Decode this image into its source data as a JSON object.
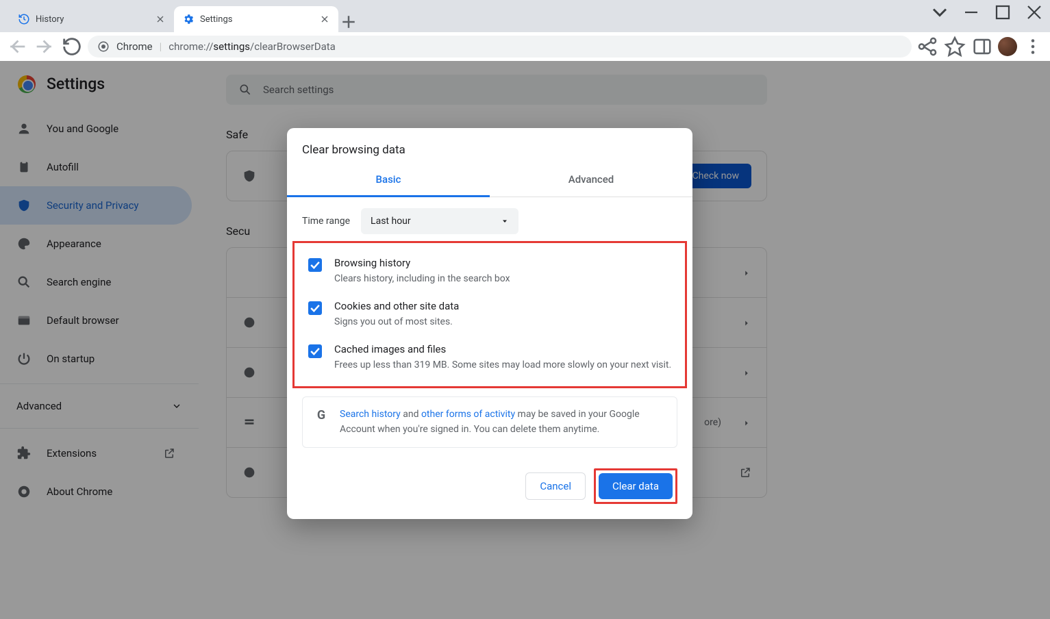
{
  "tabs": [
    {
      "label": "History"
    },
    {
      "label": "Settings"
    }
  ],
  "omnibox": {
    "label": "Chrome",
    "prefix": "chrome://",
    "segment": "settings",
    "suffix": "/clearBrowserData"
  },
  "page_title": "Settings",
  "search_placeholder": "Search settings",
  "sidebar": {
    "items": [
      {
        "label": "You and Google"
      },
      {
        "label": "Autofill"
      },
      {
        "label": "Security and Privacy"
      },
      {
        "label": "Appearance"
      },
      {
        "label": "Search engine"
      },
      {
        "label": "Default browser"
      },
      {
        "label": "On startup"
      }
    ],
    "advanced": "Advanced",
    "extensions": "Extensions",
    "about": "About Chrome"
  },
  "main": {
    "safety_heading_partial": "Safe",
    "check_now": "Check now",
    "security_heading_partial": "Secu",
    "more_partial": "ore)"
  },
  "dialog": {
    "title": "Clear browsing data",
    "tabs": {
      "basic": "Basic",
      "advanced": "Advanced"
    },
    "time_range_label": "Time range",
    "time_range_value": "Last hour",
    "options": [
      {
        "title": "Browsing history",
        "desc": "Clears history, including in the search box"
      },
      {
        "title": "Cookies and other site data",
        "desc": "Signs you out of most sites."
      },
      {
        "title": "Cached images and files",
        "desc": "Frees up less than 319 MB. Some sites may load more slowly on your next visit."
      }
    ],
    "info": {
      "link1": "Search history",
      "mid1": " and ",
      "link2": "other forms of activity",
      "tail": " may be saved in your Google Account when you're signed in. You can delete them anytime."
    },
    "cancel": "Cancel",
    "clear": "Clear data"
  }
}
